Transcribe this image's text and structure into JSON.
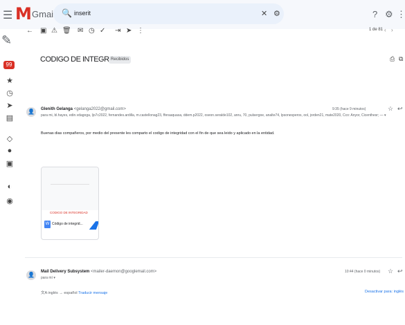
{
  "app": {
    "name": "Gmail"
  },
  "search": {
    "value": "inserit"
  },
  "email": {
    "subject": "CODIGO DE INTEGRIDAD",
    "label": "Recibidos",
    "messages": [
      {
        "sender_name": "Glenith Gelanga",
        "sender_email": "<gelanga2022@gmail.com>",
        "recipients": "para mi, bl.hayes, edin.vdagoga, ljo7c2022, fernandes.ardilla, m.castellonag23, fferaaquasa, ddem.p2022, oseon.seralde102, anru, 70, pulsergoe, analte74, lpsonesperos, ool, jorden21, mate2020, Cco: Anyor, Cicenthesr; — ▾",
        "time": "9:35 (hace 9 minutos)",
        "body": "Buenas dias compañeros, por medio del presente les comparto el codigo de integridad con el fin de que sea leido y aplicado en la entidad.",
        "attachment": {
          "title": "CODIGO DE INTEGRIDAD",
          "filename": "Código de integrid...",
          "preview_heading": "—"
        }
      },
      {
        "sender_name": "Mail Delivery Subsystem",
        "sender_email": "<mailer-daemon@googlemail.com>",
        "recipients": "para mí ▾",
        "time": "10:44 (hace 0 minutos)"
      }
    ]
  },
  "translate": {
    "from": "inglés",
    "to": "español",
    "link": "Traducir mensaje",
    "disable": "Desactivar para: inglés"
  },
  "pagination": {
    "text": "1 de 81"
  },
  "colors": {
    "gmail_red": "#d93025",
    "link_blue": "#1a73e8",
    "topbar_bg": "#f6f8fc",
    "search_bg": "#eaf1fb"
  }
}
